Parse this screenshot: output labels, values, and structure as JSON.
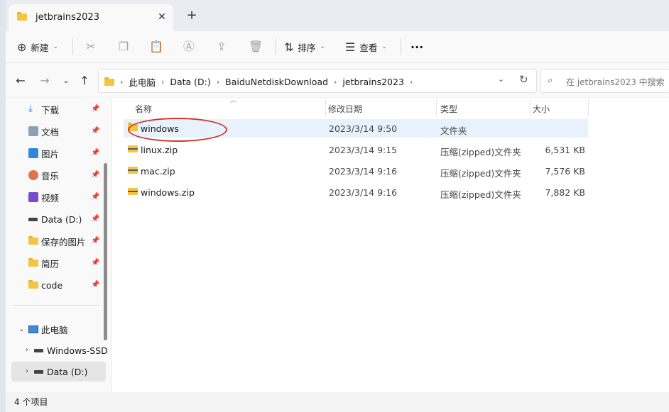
{
  "window": {
    "tab_title": "jetbrains2023",
    "close_glyph": "✕",
    "newtab_glyph": "+"
  },
  "toolbar": {
    "new_label": "新建",
    "sort_label": "排序",
    "view_label": "查看",
    "more_glyph": "···"
  },
  "nav": {
    "breadcrumbs": [
      "此电脑",
      "Data (D:)",
      "BaiduNetdiskDownload",
      "jetbrains2023"
    ],
    "search_placeholder": "在 jetbrains2023 中搜索"
  },
  "sidebar": {
    "quick_access": [
      {
        "label": "下载",
        "icon": "download-icon"
      },
      {
        "label": "文档",
        "icon": "document-icon"
      },
      {
        "label": "图片",
        "icon": "pictures-icon"
      },
      {
        "label": "音乐",
        "icon": "music-icon"
      },
      {
        "label": "视频",
        "icon": "video-icon"
      },
      {
        "label": "Data (D:)",
        "icon": "drive-icon"
      },
      {
        "label": "保存的图片",
        "icon": "folder-icon"
      },
      {
        "label": "简历",
        "icon": "folder-icon"
      },
      {
        "label": "code",
        "icon": "folder-icon"
      }
    ],
    "this_pc": "此电脑",
    "drives": [
      {
        "label": "Windows-SSD",
        "icon": "drive-icon"
      },
      {
        "label": "Data (D:)",
        "icon": "drive-icon",
        "selected": true
      }
    ]
  },
  "columns": {
    "name": "名称",
    "modified": "修改日期",
    "type": "类型",
    "size": "大小"
  },
  "files": [
    {
      "name": "windows",
      "modified": "2023/3/14 9:50",
      "type": "文件夹",
      "size": "",
      "icon": "folder-icon",
      "selected": true
    },
    {
      "name": "linux.zip",
      "modified": "2023/3/14 9:15",
      "type": "压缩(zipped)文件夹",
      "size": "6,531 KB",
      "icon": "zip-folder-icon"
    },
    {
      "name": "mac.zip",
      "modified": "2023/3/14 9:16",
      "type": "压缩(zipped)文件夹",
      "size": "7,576 KB",
      "icon": "zip-folder-icon"
    },
    {
      "name": "windows.zip",
      "modified": "2023/3/14 9:16",
      "type": "压缩(zipped)文件夹",
      "size": "7,882 KB",
      "icon": "zip-folder-icon"
    }
  ],
  "status": {
    "item_count": "4 个项目"
  },
  "colors": {
    "selection": "#e8f2fc",
    "annotation_ring": "#d4342c",
    "folder": "#f4c542"
  }
}
